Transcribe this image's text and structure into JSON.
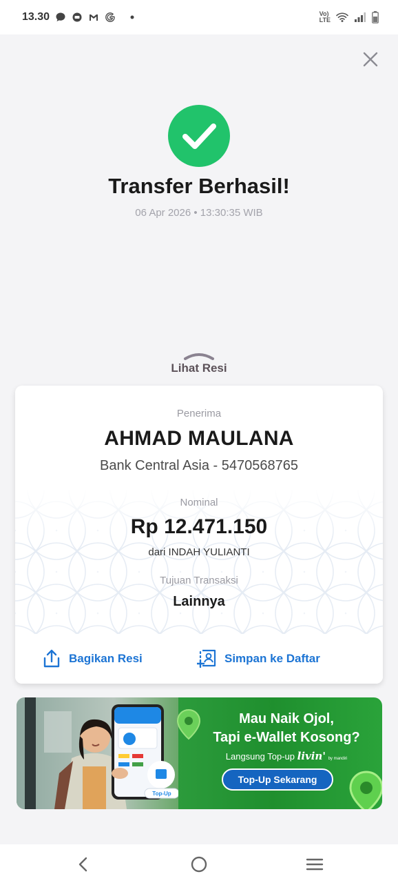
{
  "status_bar": {
    "time": "13.30",
    "network_label_top": "Vo)",
    "network_label_bottom": "LTE",
    "icons": [
      "chat-icon",
      "messenger-icon",
      "gmail-icon",
      "google-icon",
      "dot-icon",
      "volte-icon",
      "wifi-icon",
      "signal-icon",
      "battery-icon"
    ]
  },
  "success": {
    "title": "Transfer Berhasil!",
    "timestamp": "06 Apr 2026 • 13:30:35 WIB",
    "icon": "check-icon",
    "color": "#21c36b"
  },
  "receipt_toggle": {
    "label": "Lihat Resi",
    "icon": "chevron-up-icon"
  },
  "receipt": {
    "recipient_label": "Penerima",
    "recipient_name": "AHMAD MAULANA",
    "recipient_bank": "Bank Central Asia - 5470568765",
    "amount_label": "Nominal",
    "amount": "Rp 12.471.150",
    "from": "dari INDAH YULIANTI",
    "purpose_label": "Tujuan Transaksi",
    "purpose": "Lainnya"
  },
  "actions": {
    "share_label": "Bagikan Resi",
    "save_label": "Simpan ke Daftar",
    "accent": "#1c74d4"
  },
  "banner": {
    "title_line1": "Mau Naik Ojol,",
    "title_line2": "Tapi e-Wallet Kosong?",
    "subtitle": "Langsung Top-up",
    "brand": "livin'",
    "brand_by": "by mandiri",
    "cta": "Top-Up Sekarang",
    "phone_button": "Top-Up"
  },
  "nav": {
    "icons": [
      "back-icon",
      "home-icon",
      "recents-icon"
    ]
  }
}
